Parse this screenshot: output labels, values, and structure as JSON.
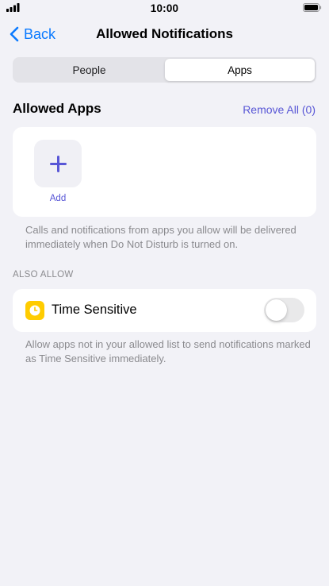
{
  "status_bar": {
    "time": "10:00"
  },
  "nav": {
    "back_label": "Back",
    "title": "Allowed Notifications"
  },
  "segmented": {
    "options": [
      "People",
      "Apps"
    ],
    "selected": "Apps"
  },
  "allowed_apps": {
    "title": "Allowed Apps",
    "remove_all": "Remove All (0)",
    "add_label": "Add",
    "footnote": "Calls and notifications from apps you allow will be delivered immediately when Do Not Disturb is turned on."
  },
  "also_allow": {
    "header": "ALSO ALLOW",
    "time_sensitive": {
      "label": "Time Sensitive",
      "enabled": false,
      "icon": "clock-icon"
    },
    "footnote": "Allow apps not in your allowed list to send notifications marked as Time Sensitive immediately."
  },
  "colors": {
    "accent": "#5856d6",
    "back_blue": "#0a7aff",
    "time_sensitive_icon": "#ffcc00"
  }
}
